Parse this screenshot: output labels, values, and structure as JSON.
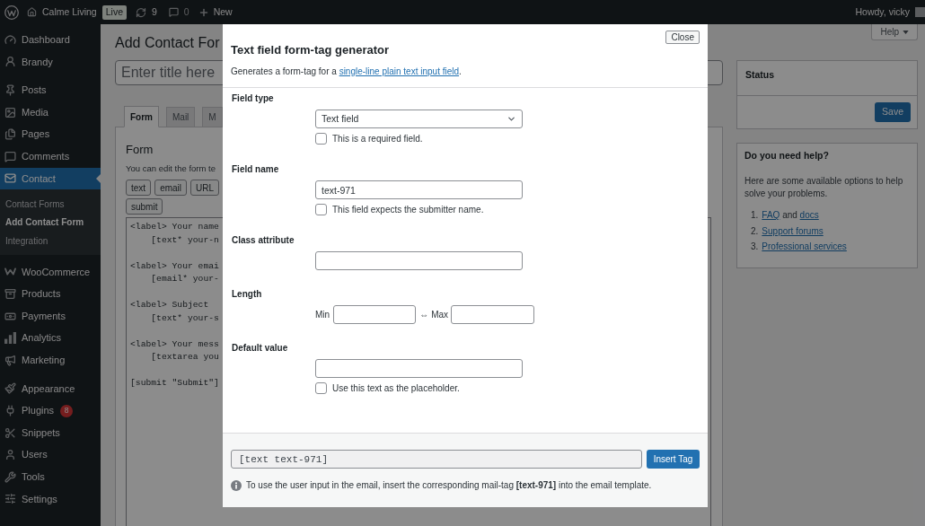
{
  "admin_bar": {
    "site_name": "Calme Living",
    "status_badge": "Live",
    "updates_count": "9",
    "comments_count": "0",
    "new_label": "New",
    "greeting": "Howdy, vicky"
  },
  "sidebar": {
    "sections": [
      {
        "items": [
          {
            "label": "Dashboard",
            "selected": false
          },
          {
            "label": "Brandy",
            "selected": false
          }
        ]
      },
      {
        "items": [
          {
            "label": "Posts",
            "selected": false
          },
          {
            "label": "Media",
            "selected": false
          },
          {
            "label": "Pages",
            "selected": false
          },
          {
            "label": "Comments",
            "selected": false
          },
          {
            "label": "Contact",
            "selected": true,
            "children": [
              {
                "label": "Contact Forms",
                "selected": false
              },
              {
                "label": "Add Contact Form",
                "selected": true
              },
              {
                "label": "Integration",
                "selected": false
              }
            ]
          }
        ]
      },
      {
        "items": [
          {
            "label": "WooCommerce",
            "selected": false
          },
          {
            "label": "Products",
            "selected": false
          },
          {
            "label": "Payments",
            "selected": false
          },
          {
            "label": "Analytics",
            "selected": false
          },
          {
            "label": "Marketing",
            "selected": false
          }
        ]
      },
      {
        "items": [
          {
            "label": "Appearance",
            "selected": false
          },
          {
            "label": "Plugins",
            "selected": false,
            "badge": "8"
          },
          {
            "label": "Snippets",
            "selected": false
          },
          {
            "label": "Users",
            "selected": false
          },
          {
            "label": "Tools",
            "selected": false
          },
          {
            "label": "Settings",
            "selected": false
          }
        ]
      }
    ]
  },
  "page": {
    "title": "Add Contact For",
    "help_button": "Help",
    "title_field": {
      "placeholder": "Enter title here"
    },
    "tabs": [
      {
        "label": "Form",
        "selected": true
      },
      {
        "label": "Mail",
        "selected": false
      },
      {
        "label": "M",
        "selected": false
      }
    ],
    "form_panel": {
      "heading": "Form",
      "description": "You can edit the form te",
      "tag_button_rows": [
        [
          "text",
          "email",
          "URL"
        ],
        [
          "submit"
        ]
      ],
      "code": "<label> Your name\n    [text* your-n\n\n<label> Your emai\n    [email* your-\n\n<label> Subject\n    [text* your-s\n\n<label> Your mess\n    [textarea you\n\n[submit \"Submit\"]"
    },
    "status_box": {
      "heading": "Status",
      "save_button": "Save"
    },
    "help_box": {
      "heading": "Do you need help?",
      "text": "Here are some available options to help solve your problems.",
      "items": [
        {
          "number": "1.",
          "parts": [
            {
              "kind": "link",
              "text": "FAQ"
            },
            {
              "kind": "text",
              "text": " and "
            },
            {
              "kind": "link",
              "text": "docs"
            }
          ]
        },
        {
          "number": "2.",
          "parts": [
            {
              "kind": "link",
              "text": "Support forums"
            }
          ]
        },
        {
          "number": "3.",
          "parts": [
            {
              "kind": "link",
              "text": "Professional services"
            }
          ]
        }
      ]
    }
  },
  "modal": {
    "title": "Text field form-tag generator",
    "close_button": "Close",
    "description": {
      "text_before": "Generates a form-tag for a ",
      "link": "single-line plain text input field",
      "text_after": "."
    },
    "fields": [
      {
        "kind": "select",
        "label": "Field type",
        "value": "Text field",
        "checkbox": {
          "label": "This is a required field.",
          "checked": false
        }
      },
      {
        "kind": "text",
        "label": "Field name",
        "value": "text-971",
        "checkbox": {
          "label": "This field expects the submitter name.",
          "checked": false
        }
      },
      {
        "kind": "text",
        "label": "Class attribute"
      },
      {
        "kind": "range",
        "label": "Length",
        "min_label": "Min",
        "separator": "⇔",
        "max_label": "Max"
      },
      {
        "kind": "text",
        "label": "Default value",
        "checkbox": {
          "label": "Use this text as the placeholder.",
          "checked": false
        }
      }
    ],
    "tag_output": "[text text-971]",
    "insert_button": "Insert Tag",
    "note": "To use the user input in the email, insert the corresponding mail-tag **[text-971]** into the email template."
  }
}
